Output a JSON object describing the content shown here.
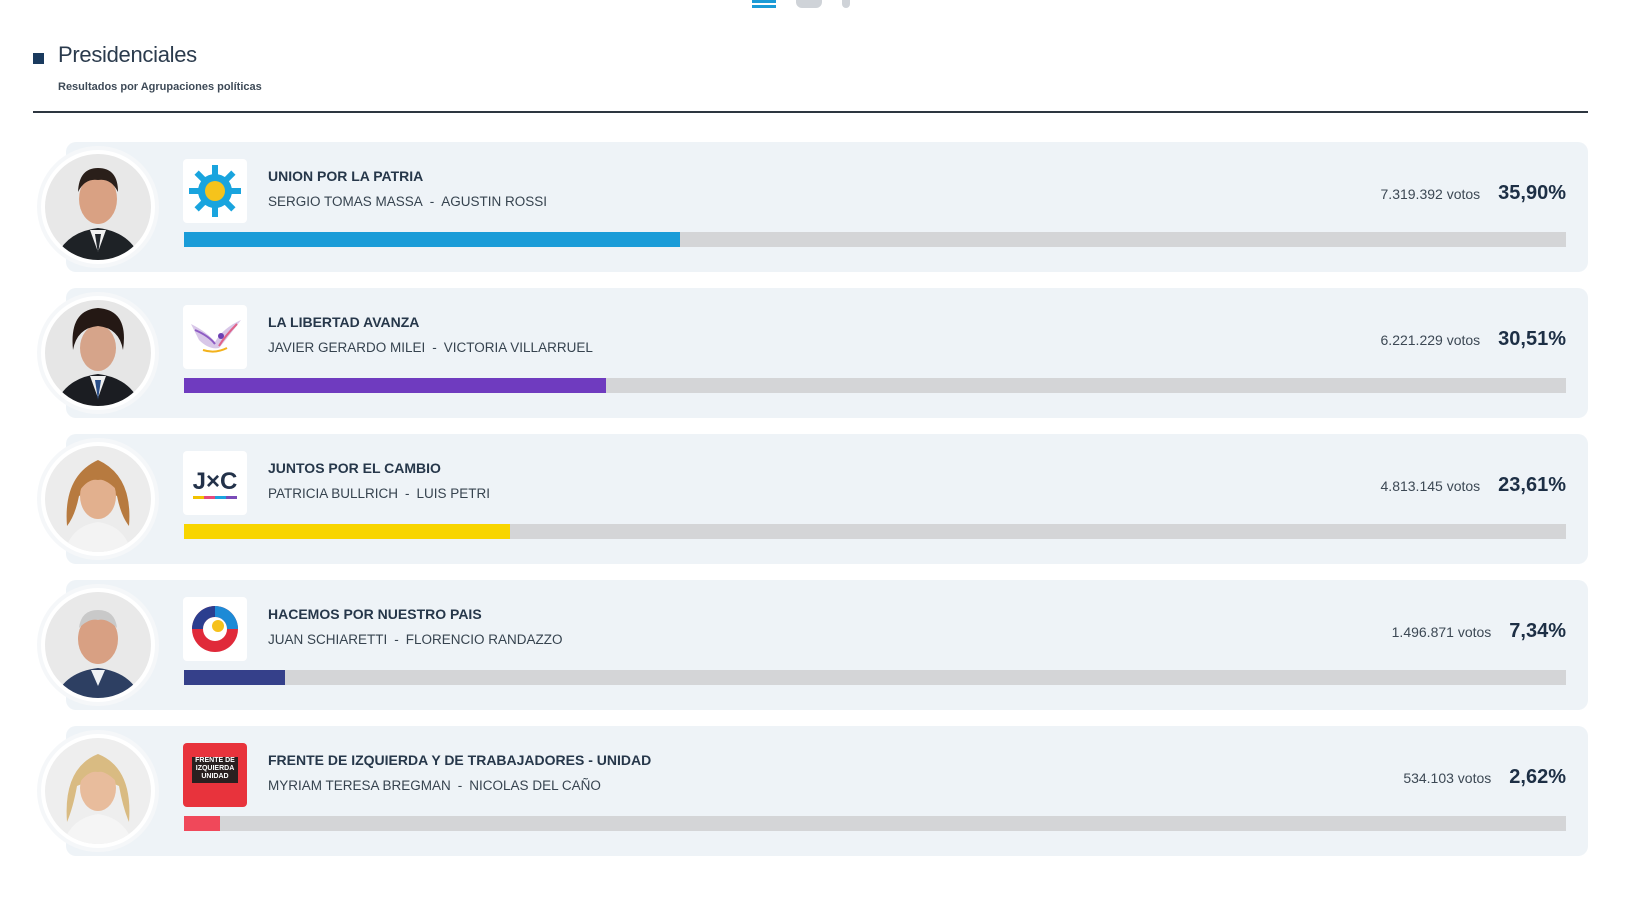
{
  "header": {
    "title": "Presidenciales",
    "subtitle": "Resultados por Agrupaciones políticas"
  },
  "colors": {
    "accent": "#1a3a5e",
    "track": "#d4d5d7",
    "card": "#eef3f7"
  },
  "results": [
    {
      "party": "UNION POR LA PATRIA",
      "candidate_president": "SERGIO TOMAS MASSA",
      "candidate_vice": "AGUSTIN ROSSI",
      "separator": "-",
      "votes": "7.319.392 votos",
      "percent_label": "35,90%",
      "percent": 35.9,
      "bar_color": "#1a9cd8",
      "logo": "up-sun-logo"
    },
    {
      "party": "LA LIBERTAD AVANZA",
      "candidate_president": "JAVIER GERARDO MILEI",
      "candidate_vice": "VICTORIA VILLARRUEL",
      "separator": "-",
      "votes": "6.221.229 votos",
      "percent_label": "30,51%",
      "percent": 30.51,
      "bar_color": "#6f3bbf",
      "logo": "lla-bird-logo"
    },
    {
      "party": "JUNTOS POR EL CAMBIO",
      "candidate_president": "PATRICIA BULLRICH",
      "candidate_vice": "LUIS PETRI",
      "separator": "-",
      "votes": "4.813.145 votos",
      "percent_label": "23,61%",
      "percent": 23.61,
      "bar_color": "#f8d500",
      "logo": "jxc-logo",
      "logo_text": "J×C"
    },
    {
      "party": "HACEMOS POR NUESTRO PAIS",
      "candidate_president": "JUAN SCHIARETTI",
      "candidate_vice": "FLORENCIO RANDAZZO",
      "separator": "-",
      "votes": "1.496.871 votos",
      "percent_label": "7,34%",
      "percent": 7.34,
      "bar_color": "#35408a",
      "logo": "hacemos-ring-logo"
    },
    {
      "party": "FRENTE DE IZQUIERDA Y DE TRABAJADORES - UNIDAD",
      "candidate_president": "MYRIAM TERESA BREGMAN",
      "candidate_vice": "NICOLAS DEL CAÑO",
      "separator": "-",
      "votes": "534.103 votos",
      "percent_label": "2,62%",
      "percent": 2.62,
      "bar_color": "#f0485a",
      "logo": "fit-logo",
      "logo_text": "FRENTE DE IZQUIERDA UNIDAD"
    }
  ]
}
